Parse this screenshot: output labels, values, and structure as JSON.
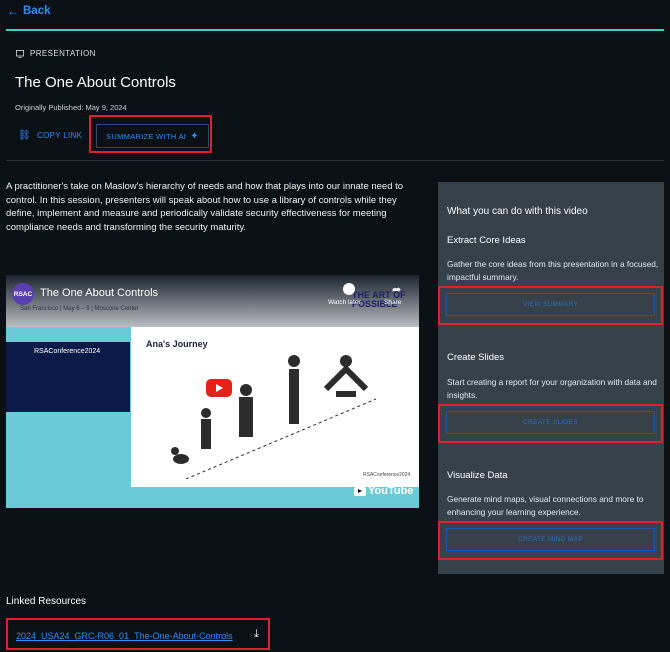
{
  "nav": {
    "back_label": "Back"
  },
  "header": {
    "kind": "PRESENTATION",
    "title": "The One About Controls",
    "published": "Originally Published: May 9, 2024",
    "copy_link": "COPY LINK",
    "summarize": "SUMMARIZE WITH AI"
  },
  "description": "A practitioner's take on Maslow's hierarchy of needs and how that plays into our innate need to control. In this session, presenters will speak about how to use a library of controls while they define, implement and measure and periodically validate security effectiveness for meeting compliance needs and transforming the security maturity.",
  "video": {
    "channel_logo": "RSAC",
    "title": "The One About Controls",
    "subtitle": "San Francisco | May 6 – 9 | Moscone Center",
    "watch_later": "Watch later",
    "share": "Share",
    "banner": "THE ART OF POSSIBLE",
    "stage_text": "RSAConference2024",
    "slide_title": "Ana's Journey",
    "slide_footer": "RSAConference2024",
    "provider": "YouTube"
  },
  "panel": {
    "heading": "What you can do with this video",
    "sections": [
      {
        "title": "Extract Core Ideas",
        "text": "Gather the core ideas from this presentation in a focused, impactful summary.",
        "button": "VIEW SUMMARY"
      },
      {
        "title": "Create Slides",
        "text": "Start creating a report for your organization with data and insights.",
        "button": "CREATE SLIDES"
      },
      {
        "title": "Visualize Data",
        "text": "Generate mind maps, visual connections and more to enhancing your learning experience.",
        "button": "CREATE MIND MAP"
      }
    ]
  },
  "resources": {
    "heading": "Linked Resources",
    "file": "2024_USA24_GRC-R06_01_The-One-About-Controls"
  },
  "colors": {
    "accent": "#2f8cff",
    "highlight": "#e0202d",
    "teal": "#3ad6c1",
    "panel": "#36414a"
  }
}
